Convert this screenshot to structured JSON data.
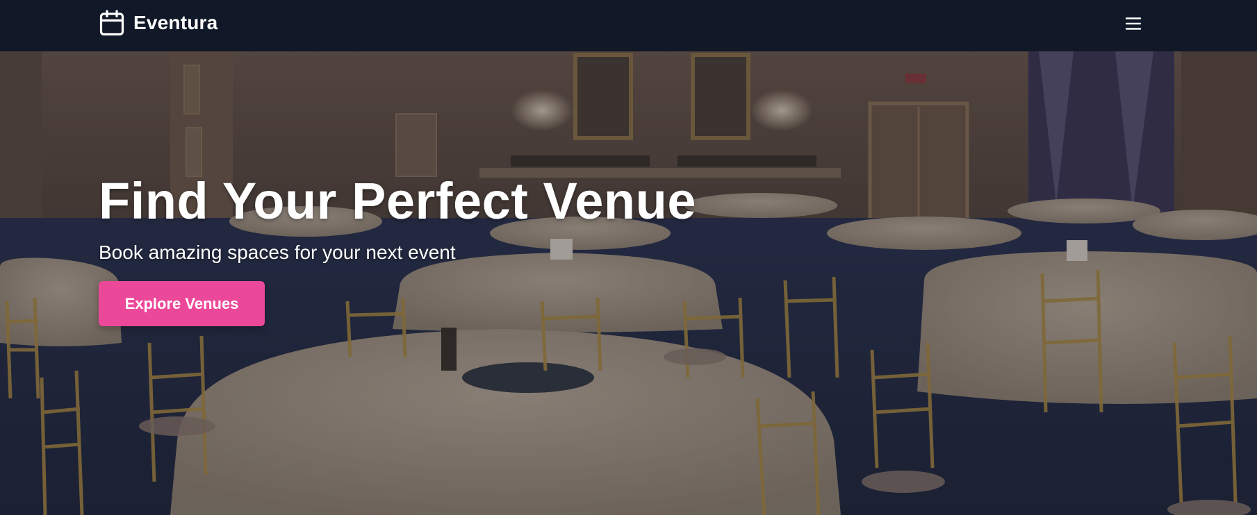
{
  "nav": {
    "brand": "Eventura",
    "brand_icon": "calendar-icon",
    "menu_icon": "hamburger-menu-icon"
  },
  "hero": {
    "title": "Find Your Perfect Venue",
    "subtitle": "Book amazing spaces for your next event",
    "cta_label": "Explore Venues",
    "background": "banquet-hall-photo"
  },
  "colors": {
    "nav_bg": "#111827",
    "accent": "#ec4899",
    "text": "#ffffff"
  }
}
